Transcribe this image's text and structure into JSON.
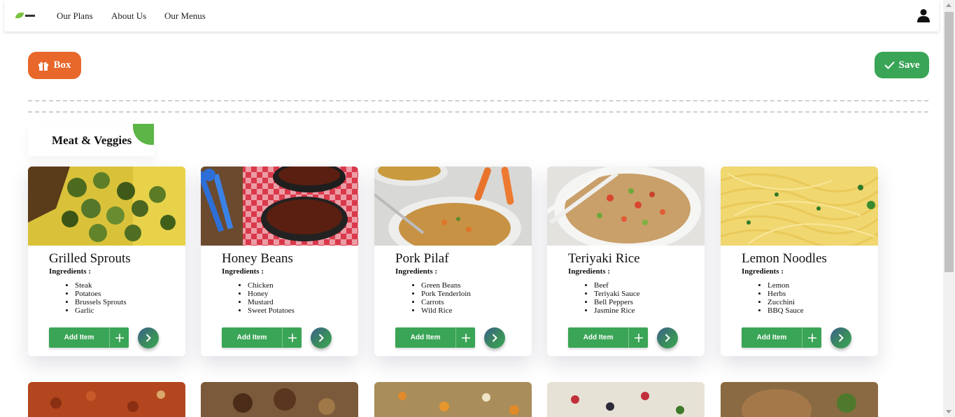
{
  "nav": {
    "links": [
      "Our Plans",
      "About Us",
      "Our Menus"
    ],
    "logo_icon": "leaf-logo-icon",
    "user_icon": "user-icon"
  },
  "actions": {
    "box_label": "Box",
    "box_icon": "gift-box-icon",
    "save_label": "Save",
    "save_icon": "check-icon"
  },
  "section": {
    "title": "Meat & Veggies"
  },
  "ingredients_label": "Ingredients :",
  "add_item_label": "Add Item",
  "colors": {
    "orange": "#e8672a",
    "green": "#3aa556",
    "leaf": "#5cb546"
  },
  "cards": [
    {
      "title": "Grilled Sprouts",
      "ingredients": [
        "Steak",
        "Potatoes",
        "Brussels Sprouts",
        "Garlic"
      ]
    },
    {
      "title": "Honey Beans",
      "ingredients": [
        "Chicken",
        "Honey",
        "Mustard",
        "Sweet Potatoes"
      ]
    },
    {
      "title": "Pork Pilaf",
      "ingredients": [
        "Green Beans",
        "Pork Tenderloin",
        "Carrots",
        "Wild Rice"
      ]
    },
    {
      "title": "Teriyaki Rice",
      "ingredients": [
        "Beef",
        "Teriyaki Sauce",
        "Bell Peppers",
        "Jasmine Rice"
      ]
    },
    {
      "title": "Lemon Noodles",
      "ingredients": [
        "Lemon",
        "Herbs",
        "Zucchini",
        "BBQ Sauce"
      ]
    }
  ]
}
